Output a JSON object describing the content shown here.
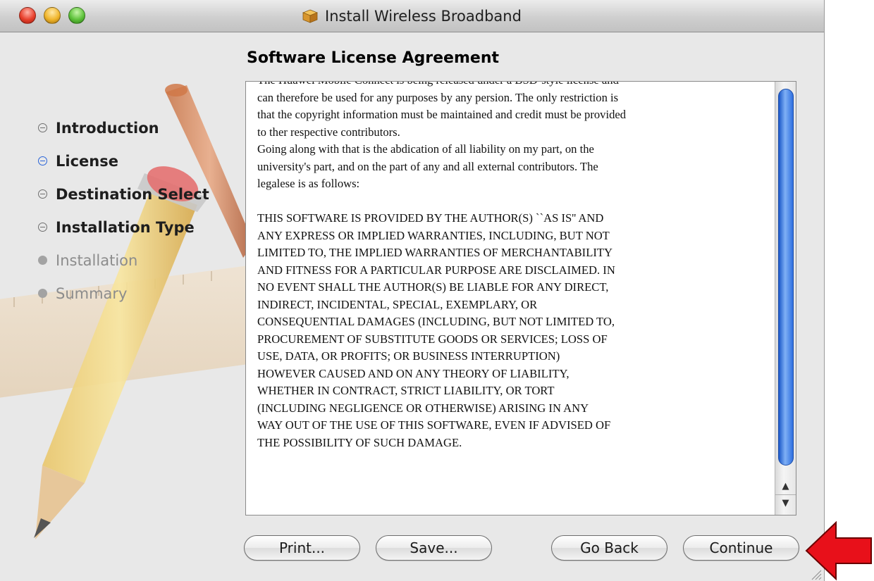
{
  "window": {
    "title": "Install Wireless Broadband",
    "icon": "package-icon"
  },
  "page_title": "Software License Agreement",
  "steps": [
    {
      "label": "Introduction",
      "state": "done"
    },
    {
      "label": "License",
      "state": "active"
    },
    {
      "label": "Destination Select",
      "state": "done"
    },
    {
      "label": "Installation Type",
      "state": "done"
    },
    {
      "label": "Installation",
      "state": "disabled"
    },
    {
      "label": "Summary",
      "state": "disabled"
    }
  ],
  "license": {
    "text": "The Huawei Mobile Connect is being released under a BSD-style license and\ncan therefore be used for any purposes by any persion. The only restriction is\nthat the copyright information must be maintained and credit must be provided\nto ther respective contributors.\nGoing along with that is the abdication of all liability on my part, on the\nuniversity's part, and on the part of any and all external contributors. The\nlegalese is as follows:\n\nTHIS SOFTWARE IS PROVIDED BY THE AUTHOR(S) ``AS IS'' AND\nANY EXPRESS OR IMPLIED WARRANTIES, INCLUDING, BUT NOT\nLIMITED TO, THE IMPLIED WARRANTIES OF MERCHANTABILITY\nAND FITNESS FOR A PARTICULAR PURPOSE ARE DISCLAIMED. IN\nNO EVENT SHALL THE AUTHOR(S) BE LIABLE FOR ANY DIRECT,\nINDIRECT, INCIDENTAL, SPECIAL, EXEMPLARY, OR\nCONSEQUENTIAL DAMAGES (INCLUDING, BUT NOT LIMITED TO,\nPROCUREMENT OF SUBSTITUTE GOODS OR SERVICES; LOSS OF\nUSE, DATA, OR PROFITS; OR BUSINESS INTERRUPTION)\nHOWEVER CAUSED AND ON ANY THEORY OF LIABILITY,\nWHETHER IN CONTRACT, STRICT LIABILITY, OR TORT\n(INCLUDING NEGLIGENCE OR OTHERWISE) ARISING IN ANY\nWAY OUT OF THE USE OF THIS SOFTWARE, EVEN IF ADVISED OF\nTHE POSSIBILITY OF SUCH DAMAGE."
  },
  "buttons": {
    "print": "Print...",
    "save": "Save...",
    "go_back": "Go Back",
    "continue": "Continue"
  },
  "colors": {
    "active_step": "#2a64d8",
    "scroll_thumb": "#2f6fe0",
    "annotation_arrow": "#e8101a"
  }
}
